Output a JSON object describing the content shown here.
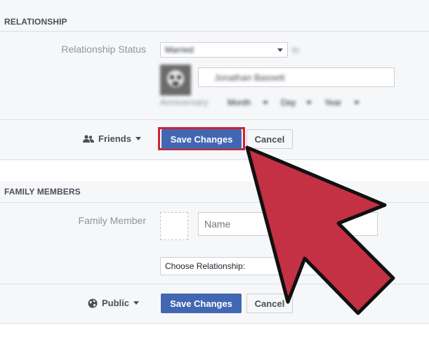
{
  "relationship": {
    "header": "RELATIONSHIP",
    "status_label": "Relationship Status",
    "status_value": "Married",
    "status_suffix": "to",
    "partner_name": "Jonathan Bassett",
    "anniversary_label": "Anniversary",
    "anniversary_month": "Month",
    "anniversary_day": "Day",
    "anniversary_year": "Year",
    "privacy": "Friends",
    "save_label": "Save Changes",
    "cancel_label": "Cancel"
  },
  "family": {
    "header": "FAMILY MEMBERS",
    "member_label": "Family Member",
    "name_placeholder": "Name",
    "relationship_select": "Choose Relationship:",
    "privacy": "Public",
    "save_label": "Save Changes",
    "cancel_label": "Cancel"
  },
  "colors": {
    "primary_button": "#4267b2",
    "highlight_border": "#d0222f",
    "arrow_fill": "#c43044"
  }
}
